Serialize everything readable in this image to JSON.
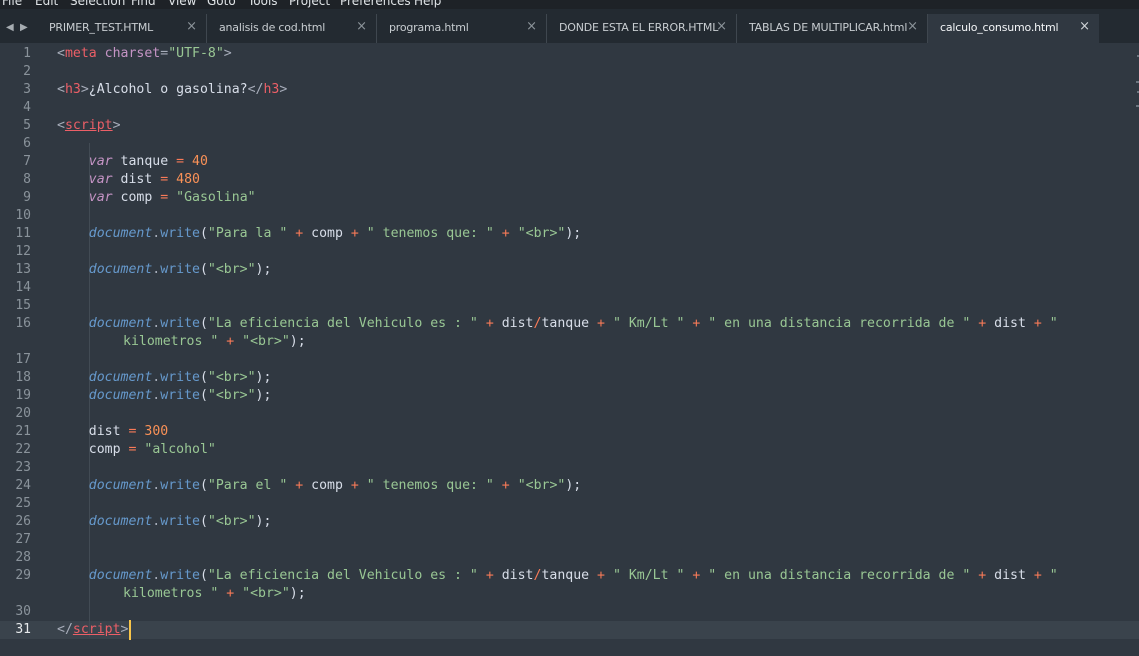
{
  "menu": [
    "File",
    "Edit",
    "Selection",
    "Find",
    "View",
    "Goto",
    "Tools",
    "Project",
    "Preferences",
    "Help"
  ],
  "nav": {
    "back": "◀",
    "forward": "▶"
  },
  "tabs": [
    {
      "label": "PRIMER_TEST.HTML",
      "close": "×",
      "active": false
    },
    {
      "label": "analisis de cod.html",
      "close": "×",
      "active": false
    },
    {
      "label": "programa.html",
      "close": "×",
      "active": false
    },
    {
      "label": "DONDE ESTA EL ERROR.HTML",
      "close": "×",
      "active": false
    },
    {
      "label": "TABLAS DE MULTIPLICAR.html",
      "close": "×",
      "active": false
    },
    {
      "label": "calculo_consumo.html",
      "close": "×",
      "active": true
    }
  ],
  "current_line": 31,
  "code": {
    "l1": {
      "tag_open": "<",
      "tag": "meta",
      "attr": "charset",
      "eq": "=",
      "value": "\"UTF-8\"",
      "tag_close": ">"
    },
    "l3": {
      "open_lt": "<",
      "open_tag": "h3",
      "open_gt": ">",
      "text": "¿Alcohol o gasolina?",
      "close_lt": "</",
      "close_tag": "h3",
      "close_gt": ">"
    },
    "l5": {
      "lt": "<",
      "tag": "script",
      "gt": ">"
    },
    "l7": {
      "kw": "var",
      "name": "tanque",
      "op": "=",
      "val": "40"
    },
    "l8": {
      "kw": "var",
      "name": "dist",
      "op": "=",
      "val": "480"
    },
    "l9": {
      "kw": "var",
      "name": "comp",
      "op": "=",
      "val": "\"Gasolina\""
    },
    "l11": {
      "obj": "document",
      "dot": ".",
      "fn": "write",
      "p1": "(",
      "s1": "\"Para la \"",
      "o1": "+",
      "v1": "comp",
      "o2": "+",
      "s2": "\" tenemos que: \"",
      "o3": "+",
      "s3": "\"<br>\"",
      "end": ");"
    },
    "l13": {
      "obj": "document",
      "dot": ".",
      "fn": "write",
      "p1": "(",
      "s1": "\"<br>\"",
      "end": ");"
    },
    "l16": {
      "obj": "document",
      "dot": ".",
      "fn": "write",
      "p1": "(",
      "s1": "\"La eficiencia del Vehiculo es : \"",
      "o1": "+",
      "v1": "dist",
      "div": "/",
      "v2": "tanque",
      "o2": "+",
      "s2": "\" Km/Lt \"",
      "o3": "+",
      "s3": "\" en una distancia recorrida de \"",
      "o4": "+",
      "v3": "dist",
      "o5": "+",
      "s4a": "\""
    },
    "l16w": {
      "s4b": "kilometros \"",
      "o6": "+",
      "s5": "\"<br>\"",
      "end": ");"
    },
    "l18": {
      "obj": "document",
      "dot": ".",
      "fn": "write",
      "p1": "(",
      "s1": "\"<br>\"",
      "end": ");"
    },
    "l19": {
      "obj": "document",
      "dot": ".",
      "fn": "write",
      "p1": "(",
      "s1": "\"<br>\"",
      "end": ");"
    },
    "l21": {
      "name": "dist",
      "op": "=",
      "val": "300"
    },
    "l22": {
      "name": "comp",
      "op": "=",
      "val": "\"alcohol\""
    },
    "l24": {
      "obj": "document",
      "dot": ".",
      "fn": "write",
      "p1": "(",
      "s1": "\"Para el \"",
      "o1": "+",
      "v1": "comp",
      "o2": "+",
      "s2": "\" tenemos que: \"",
      "o3": "+",
      "s3": "\"<br>\"",
      "end": ");"
    },
    "l26": {
      "obj": "document",
      "dot": ".",
      "fn": "write",
      "p1": "(",
      "s1": "\"<br>\"",
      "end": ");"
    },
    "l29": {
      "obj": "document",
      "dot": ".",
      "fn": "write",
      "p1": "(",
      "s1": "\"La eficiencia del Vehiculo es : \"",
      "o1": "+",
      "v1": "dist",
      "div": "/",
      "v2": "tanque",
      "o2": "+",
      "s2": "\" Km/Lt \"",
      "o3": "+",
      "s3": "\" en una distancia recorrida de \"",
      "o4": "+",
      "v3": "dist",
      "o5": "+",
      "s4a": "\""
    },
    "l29w": {
      "s4b": "kilometros \"",
      "o6": "+",
      "s5": "\"<br>\"",
      "end": ");"
    },
    "l31": {
      "lt": "</",
      "tag": "script",
      "gt": ">"
    }
  },
  "colors": {
    "background": "#303841",
    "tag": "#ec5f67",
    "string": "#99c794",
    "number": "#f99157",
    "keyword": "#c594c5",
    "function": "#6699cc",
    "caret": "#f8c54a"
  }
}
